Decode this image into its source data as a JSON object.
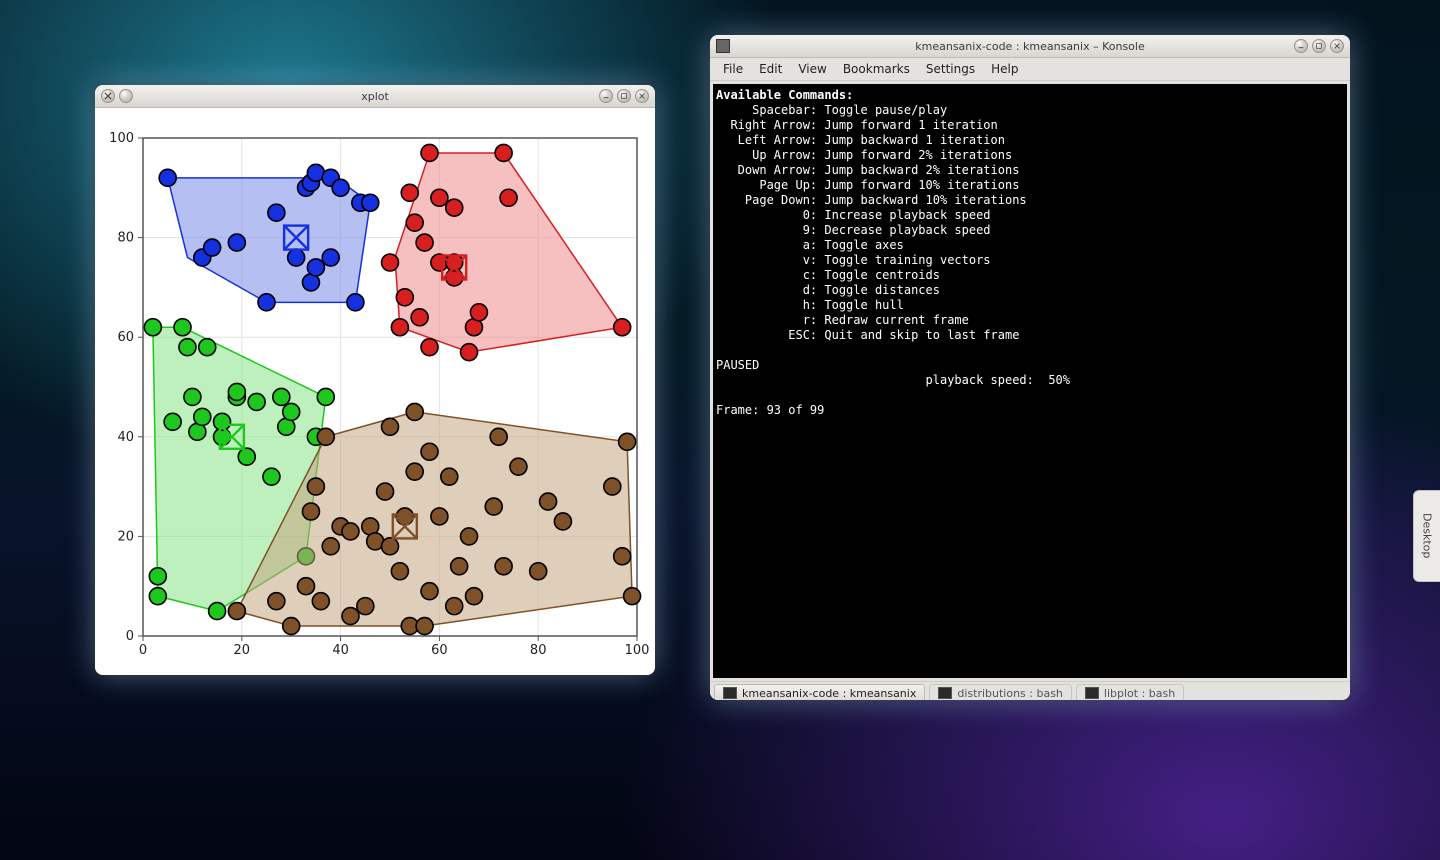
{
  "desktop": {
    "side_tab_label": "Desktop"
  },
  "xplot": {
    "title": "xplot"
  },
  "konsole": {
    "title": "kmeansanix-code : kmeansanix – Konsole",
    "menu": [
      "File",
      "Edit",
      "View",
      "Bookmarks",
      "Settings",
      "Help"
    ],
    "tabs": [
      {
        "label": "kmeansanix-code : kmeansanix",
        "active": true
      },
      {
        "label": "distributions : bash",
        "active": false
      },
      {
        "label": "libplot : bash",
        "active": false
      }
    ],
    "term": {
      "header": "Available Commands:",
      "commands": [
        {
          "key": "Spacebar",
          "desc": "Toggle pause/play"
        },
        {
          "key": "Right Arrow",
          "desc": "Jump forward 1 iteration"
        },
        {
          "key": "Left Arrow",
          "desc": "Jump backward 1 iteration"
        },
        {
          "key": "Up Arrow",
          "desc": "Jump forward 2% iterations"
        },
        {
          "key": "Down Arrow",
          "desc": "Jump backward 2% iterations"
        },
        {
          "key": "Page Up",
          "desc": "Jump forward 10% iterations"
        },
        {
          "key": "Page Down",
          "desc": "Jump backward 10% iterations"
        },
        {
          "key": "0",
          "desc": "Increase playback speed"
        },
        {
          "key": "9",
          "desc": "Decrease playback speed"
        },
        {
          "key": "a",
          "desc": "Toggle axes"
        },
        {
          "key": "v",
          "desc": "Toggle training vectors"
        },
        {
          "key": "c",
          "desc": "Toggle centroids"
        },
        {
          "key": "d",
          "desc": "Toggle distances"
        },
        {
          "key": "h",
          "desc": "Toggle hull"
        },
        {
          "key": "r",
          "desc": "Redraw current frame"
        },
        {
          "key": "ESC",
          "desc": "Quit and skip to last frame"
        }
      ],
      "status": "PAUSED",
      "speed_label": "playback speed:",
      "speed_value": "50%",
      "frame_label": "Frame:",
      "frame_value": "93 of 99"
    }
  },
  "chart_data": {
    "type": "scatter",
    "title": "",
    "xlabel": "",
    "ylabel": "",
    "xlim": [
      0,
      100
    ],
    "ylim": [
      0,
      100
    ],
    "xticks": [
      0,
      20,
      40,
      60,
      80,
      100
    ],
    "yticks": [
      0,
      20,
      40,
      60,
      80,
      100
    ],
    "grid": true,
    "clusters": [
      {
        "name": "blue",
        "color": "#1531df",
        "fill": "#7a8be8",
        "centroid": [
          31,
          80
        ],
        "hull": [
          [
            5,
            92
          ],
          [
            39,
            92
          ],
          [
            46,
            87
          ],
          [
            43,
            67
          ],
          [
            25,
            67
          ],
          [
            9,
            76
          ]
        ],
        "points": [
          [
            5,
            92
          ],
          [
            12,
            76
          ],
          [
            14,
            78
          ],
          [
            19,
            79
          ],
          [
            25,
            67
          ],
          [
            27,
            85
          ],
          [
            31,
            76
          ],
          [
            33,
            90
          ],
          [
            34,
            91
          ],
          [
            35,
            93
          ],
          [
            34,
            71
          ],
          [
            35,
            74
          ],
          [
            38,
            76
          ],
          [
            38,
            92
          ],
          [
            40,
            90
          ],
          [
            43,
            67
          ],
          [
            44,
            87
          ],
          [
            46,
            87
          ]
        ]
      },
      {
        "name": "red",
        "color": "#d71f1f",
        "fill": "#f08d8d",
        "centroid": [
          63,
          74
        ],
        "hull": [
          [
            51,
            76
          ],
          [
            58,
            97
          ],
          [
            73,
            97
          ],
          [
            97,
            62
          ],
          [
            66,
            57
          ],
          [
            52,
            62
          ]
        ],
        "points": [
          [
            50,
            75
          ],
          [
            52,
            62
          ],
          [
            53,
            68
          ],
          [
            54,
            89
          ],
          [
            55,
            83
          ],
          [
            56,
            64
          ],
          [
            57,
            79
          ],
          [
            58,
            97
          ],
          [
            58,
            58
          ],
          [
            60,
            75
          ],
          [
            60,
            88
          ],
          [
            63,
            72
          ],
          [
            63,
            75
          ],
          [
            63,
            86
          ],
          [
            66,
            57
          ],
          [
            67,
            62
          ],
          [
            68,
            65
          ],
          [
            73,
            97
          ],
          [
            74,
            88
          ],
          [
            97,
            62
          ]
        ]
      },
      {
        "name": "green",
        "color": "#1ec71e",
        "fill": "#86e486",
        "centroid": [
          18,
          40
        ],
        "hull": [
          [
            2,
            62
          ],
          [
            8,
            62
          ],
          [
            37,
            48
          ],
          [
            33,
            16
          ],
          [
            15,
            5
          ],
          [
            3,
            8
          ]
        ],
        "points": [
          [
            2,
            62
          ],
          [
            3,
            12
          ],
          [
            3,
            8
          ],
          [
            6,
            43
          ],
          [
            8,
            62
          ],
          [
            9,
            58
          ],
          [
            10,
            48
          ],
          [
            11,
            41
          ],
          [
            12,
            44
          ],
          [
            13,
            58
          ],
          [
            15,
            5
          ],
          [
            16,
            40
          ],
          [
            16,
            43
          ],
          [
            19,
            48
          ],
          [
            19,
            49
          ],
          [
            21,
            36
          ],
          [
            23,
            47
          ],
          [
            26,
            32
          ],
          [
            28,
            48
          ],
          [
            29,
            42
          ],
          [
            30,
            45
          ],
          [
            33,
            16
          ],
          [
            35,
            40
          ],
          [
            37,
            48
          ]
        ]
      },
      {
        "name": "brown",
        "color": "#7e5129",
        "fill": "#c5a57f",
        "centroid": [
          53,
          22
        ],
        "hull": [
          [
            19,
            5
          ],
          [
            37,
            40
          ],
          [
            55,
            45
          ],
          [
            98,
            39
          ],
          [
            99,
            8
          ],
          [
            57,
            2
          ],
          [
            30,
            2
          ]
        ],
        "points": [
          [
            19,
            5
          ],
          [
            27,
            7
          ],
          [
            30,
            2
          ],
          [
            33,
            10
          ],
          [
            34,
            25
          ],
          [
            35,
            30
          ],
          [
            36,
            7
          ],
          [
            37,
            40
          ],
          [
            38,
            18
          ],
          [
            40,
            22
          ],
          [
            42,
            4
          ],
          [
            42,
            21
          ],
          [
            45,
            6
          ],
          [
            46,
            22
          ],
          [
            47,
            19
          ],
          [
            49,
            29
          ],
          [
            50,
            18
          ],
          [
            50,
            42
          ],
          [
            52,
            13
          ],
          [
            53,
            24
          ],
          [
            54,
            2
          ],
          [
            55,
            33
          ],
          [
            55,
            45
          ],
          [
            57,
            2
          ],
          [
            58,
            9
          ],
          [
            58,
            37
          ],
          [
            60,
            24
          ],
          [
            62,
            32
          ],
          [
            63,
            6
          ],
          [
            64,
            14
          ],
          [
            66,
            20
          ],
          [
            67,
            8
          ],
          [
            71,
            26
          ],
          [
            72,
            40
          ],
          [
            73,
            14
          ],
          [
            76,
            34
          ],
          [
            80,
            13
          ],
          [
            82,
            27
          ],
          [
            85,
            23
          ],
          [
            95,
            30
          ],
          [
            97,
            16
          ],
          [
            98,
            39
          ],
          [
            99,
            8
          ]
        ]
      }
    ]
  }
}
